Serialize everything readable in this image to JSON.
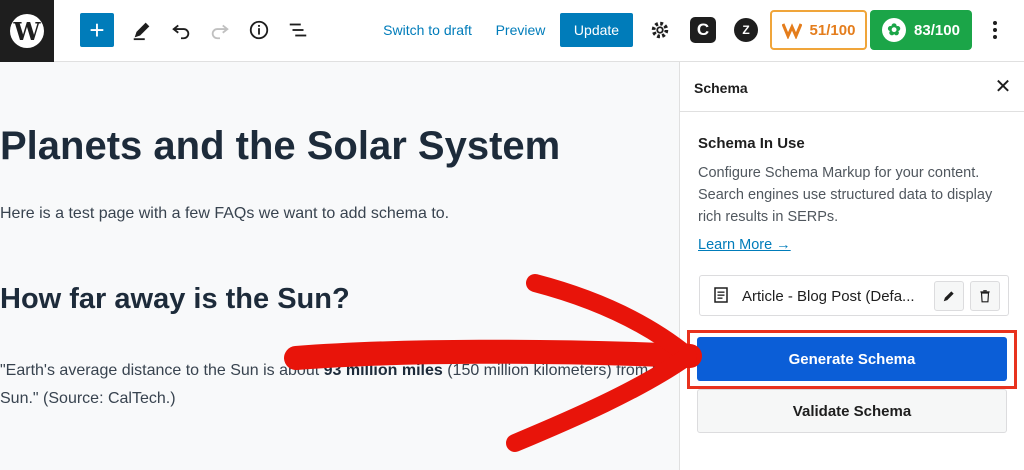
{
  "toolbar": {
    "logo_glyph": "W",
    "add_glyph": "+",
    "switch_to_draft": "Switch to draft",
    "preview": "Preview",
    "update": "Update",
    "seo_score": "51/100",
    "rank_score": "83/100",
    "icons": [
      "wordpress-logo-icon",
      "add-block-icon",
      "pencil-icon",
      "undo-icon",
      "redo-icon",
      "info-icon",
      "list-view-icon",
      "gear-icon",
      "c-plugin-icon",
      "z-plugin-icon",
      "seo-m-icon",
      "rank-gear-icon",
      "more-vertical-icon"
    ]
  },
  "editor": {
    "title": "Planets and the Solar System",
    "intro": "Here is a test page with a few FAQs we want to add schema to.",
    "heading": "How far away is the Sun?",
    "quote_start": "\"Earth's average distance to the Sun is about ",
    "quote_bold": "93 million miles",
    "quote_end": " (150 million kilometers) from the Sun.\" (Source: CalTech.)"
  },
  "sidebar": {
    "title": "Schema",
    "section_title": "Schema In Use",
    "description": "Configure Schema Markup for your content. Search engines use structured data to display rich results in SERPs.",
    "learn_more": "Learn More →",
    "schema_item": "Article - Blog Post (Defa...",
    "generate": "Generate Schema",
    "validate": "Validate Schema"
  },
  "colors": {
    "accent": "#007cba",
    "generate": "#0b5ed7",
    "arrow": "#e8140a",
    "score_orange": "#e47d1c",
    "score_green": "#1ba548"
  }
}
